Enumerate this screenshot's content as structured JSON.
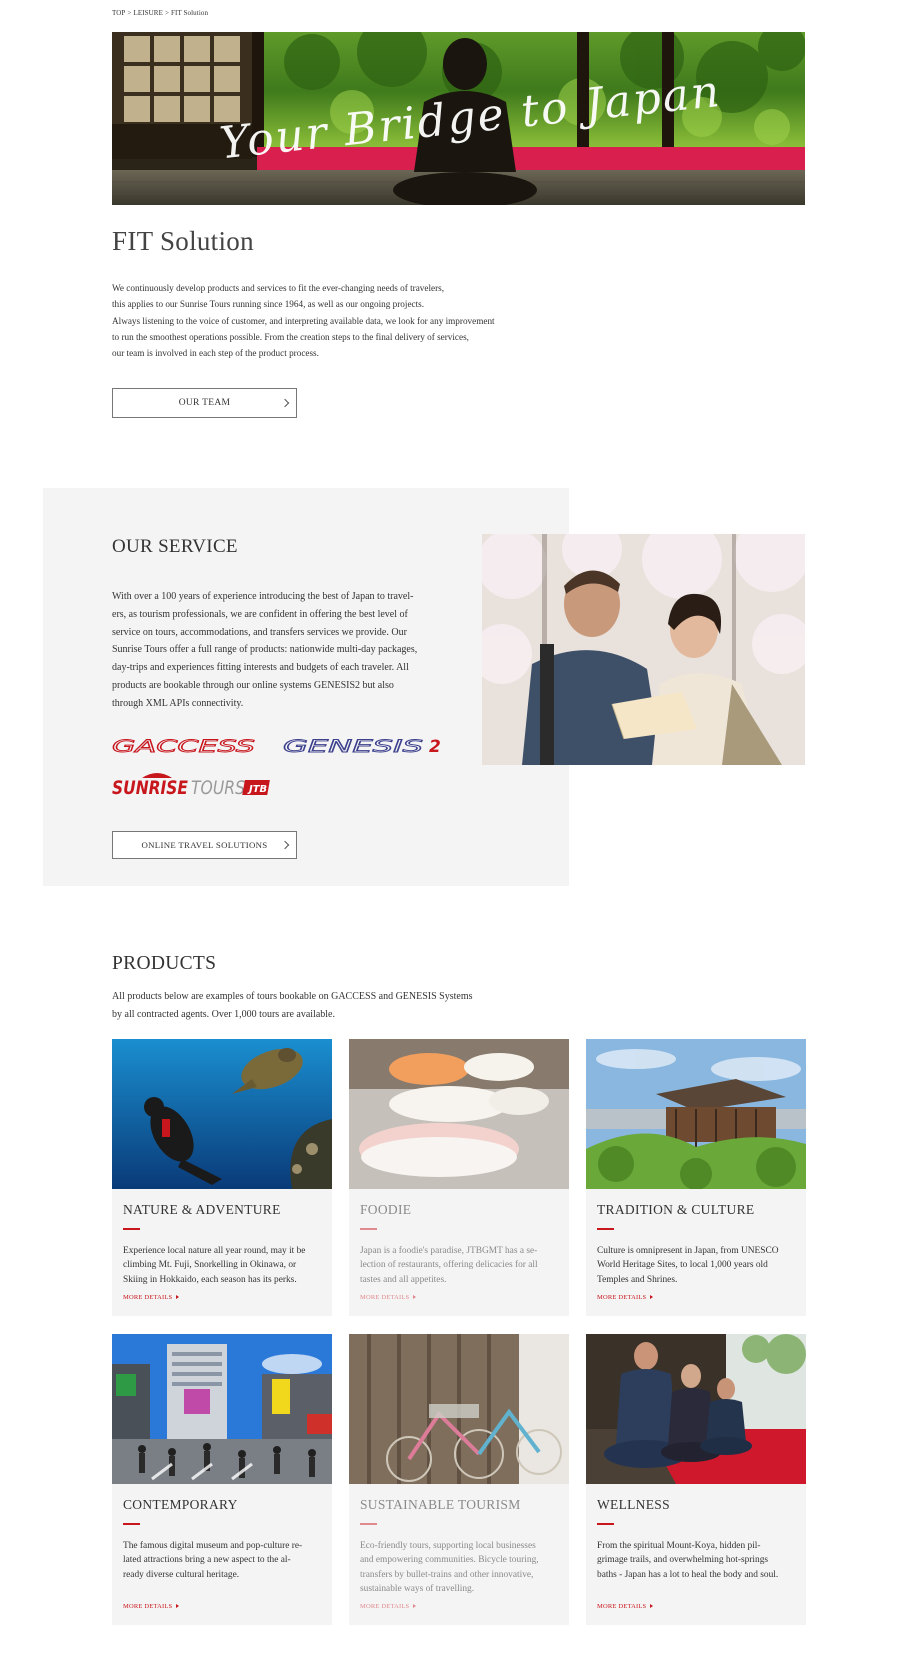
{
  "breadcrumb": {
    "top": "TOP",
    "sep1": ">",
    "leisure": "LEISURE",
    "sep2": ">",
    "current": "FIT Solution"
  },
  "hero": {
    "tagline": "Your Bridge to Japan"
  },
  "page_title": "FIT Solution",
  "intro_lines": [
    "We continuously develop products and services to fit the ever-changing needs of travelers,",
    "this applies to our Sunrise Tours running since 1964, as well as our ongoing projects.",
    "Always listening to the voice of customer, and interpreting available data, we look for any improvement",
    "to run the smoothest operations possible. From the creation steps to the final delivery of services,",
    "our team is involved in each step of the product process."
  ],
  "team_button": "OUR TEAM",
  "service": {
    "title": "OUR SERVICE",
    "lines": [
      "With over a 100 years of experience introducing the best of Japan to travel-",
      "ers, as tourism professionals, we are confident in offering the best level of",
      "service on tours, accommodations, and transfers services we provide. Our",
      "Sunrise Tours offer a full range of products: nationwide multi-day packages,",
      "day-trips and experiences fitting interests and budgets of each traveler. All",
      "products are bookable through our online systems GENESIS2 but also",
      "through XML APIs connectivity."
    ],
    "logos": {
      "gaccess": "GACCESS",
      "genesis": "GENESIS",
      "genesis_num": "2",
      "sunrise": "SUNRISE",
      "tours": "TOURS",
      "jtb": "JTB"
    },
    "button": "ONLINE TRAVEL SOLUTIONS"
  },
  "products": {
    "title": "PRODUCTS",
    "desc_lines": [
      "All products below are examples of tours bookable on GACCESS and GENESIS Systems",
      "by all contracted agents. Over 1,000 tours are available."
    ],
    "more_label": "MORE DETAILS",
    "cards": [
      {
        "title": "NATURE & ADVENTURE",
        "lines": [
          "Experience local nature all year round, may it be",
          "climbing Mt. Fuji, Snorkelling in Okinawa, or",
          "Skiing in Hokkaido, each season has its perks."
        ]
      },
      {
        "title": "FOODIE",
        "lines": [
          "Japan is a foodie's paradise, JTBGMT has a se-",
          "lection of restaurants, offering delicacies for all",
          "tastes and all appetites."
        ]
      },
      {
        "title": "TRADITION & CULTURE",
        "lines": [
          "Culture is omnipresent in Japan, from UNESCO",
          "World Heritage Sites, to local 1,000 years old",
          "Temples and Shrines."
        ]
      },
      {
        "title": "CONTEMPORARY",
        "lines": [
          "The famous digital museum and pop-culture re-",
          "lated attractions bring a new aspect to the al-",
          "ready diverse cultural heritage."
        ]
      },
      {
        "title": "SUSTAINABLE TOURISM",
        "lines": [
          "Eco-friendly tours, supporting local businesses",
          "and empowering communities. Bicycle touring,",
          "transfers by bullet-trains and other innovative,",
          "sustainable ways of travelling."
        ]
      },
      {
        "title": "WELLNESS",
        "lines": [
          "From the spiritual Mount-Koya, hidden pil-",
          "grimage trails, and overwhelming hot-springs",
          "baths - Japan has a lot to heal the body and soul."
        ]
      }
    ]
  },
  "colors": {
    "accent_red": "#c8161d",
    "genesis_blue": "#3b3f8c",
    "panel_gray": "#f4f4f5"
  }
}
